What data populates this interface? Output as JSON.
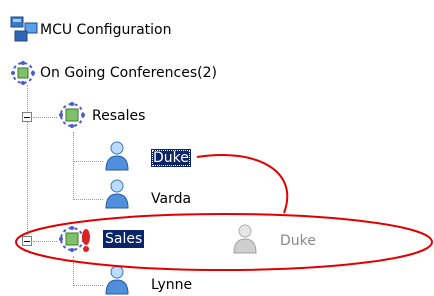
{
  "tree": {
    "root": {
      "label": "MCU Configuration",
      "icon": "mcu-configuration-icon"
    },
    "ongoing": {
      "label": "On Going Conferences(2)",
      "icon": "conferences-gear-icon"
    },
    "conferences": [
      {
        "label": "Resales",
        "icon": "conference-icon",
        "expander": "collapse",
        "participants": [
          {
            "label": "Duke",
            "icon": "participant-icon",
            "selected": true
          },
          {
            "label": "Varda",
            "icon": "participant-icon",
            "selected": false
          }
        ]
      },
      {
        "label": "Sales",
        "icon": "conference-alert-icon",
        "expander": "collapse",
        "selected": true,
        "participants": [
          {
            "label": "Lynne",
            "icon": "participant-icon",
            "selected": false
          }
        ]
      }
    ],
    "drag_ghost": {
      "label": "Duke",
      "icon": "participant-ghost-icon"
    }
  },
  "annotation": {
    "shape": "ellipse-with-arrow",
    "color": "#e00000"
  },
  "colors": {
    "selection": "#0a246a",
    "ghost_text": "#8a8a8a",
    "tree_lines": "#9a9a9a"
  }
}
